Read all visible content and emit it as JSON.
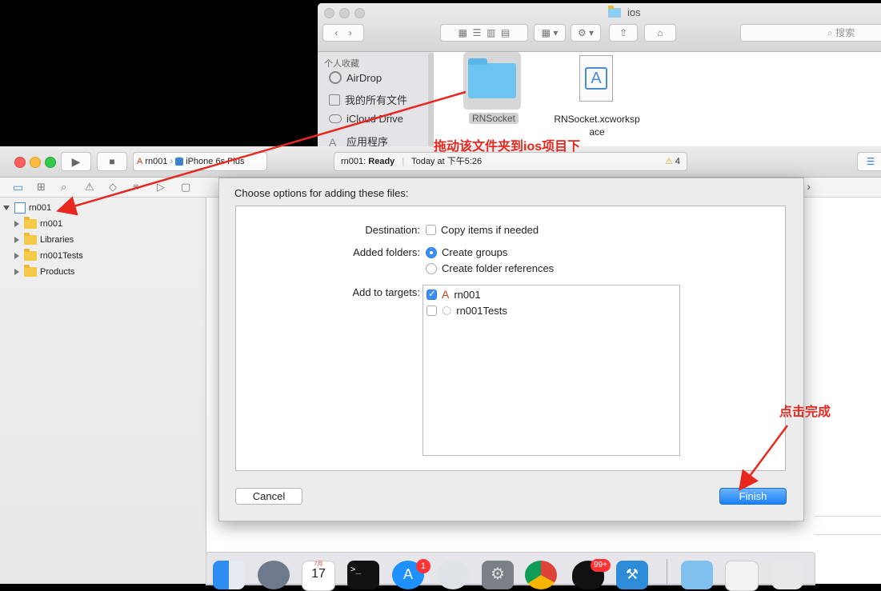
{
  "finder": {
    "title": "ios",
    "search_placeholder": "搜索",
    "sidebar_heading": "个人收藏",
    "sidebar_items": [
      {
        "label": "AirDrop",
        "icon": "airdrop-icon"
      },
      {
        "label": "我的所有文件",
        "icon": "all-files-icon"
      },
      {
        "label": "iCloud Drive",
        "icon": "icloud-icon"
      },
      {
        "label": "应用程序",
        "icon": "applications-icon"
      }
    ],
    "files": [
      {
        "name": "RNSocket",
        "icon": "folder-icon",
        "selected": true
      },
      {
        "name": "RNSocket.xcworksp ace",
        "icon": "xcworkspace-icon",
        "selected": false
      }
    ]
  },
  "xcode": {
    "scheme": "rn001",
    "device": "iPhone 6s Plus",
    "status_project": "rn001:",
    "status_state": "Ready",
    "status_time": "Today at 下午5:26",
    "warning_count": "4",
    "navigator": [
      {
        "label": "rn001",
        "level": 0,
        "open": true,
        "kind": "project"
      },
      {
        "label": "rn001",
        "level": 1,
        "open": false,
        "kind": "folder"
      },
      {
        "label": "Libraries",
        "level": 1,
        "open": false,
        "kind": "folder"
      },
      {
        "label": "rn001Tests",
        "level": 1,
        "open": false,
        "kind": "folder"
      },
      {
        "label": "Products",
        "level": 1,
        "open": false,
        "kind": "folder"
      }
    ]
  },
  "dialog": {
    "title": "Choose options for adding these files:",
    "destination_label": "Destination:",
    "copy_items": {
      "label": "Copy items if needed",
      "checked": false
    },
    "added_folders_label": "Added folders:",
    "create_groups": {
      "label": "Create groups",
      "selected": true
    },
    "create_folder_refs": {
      "label": "Create folder references",
      "selected": false
    },
    "targets_label": "Add to targets:",
    "targets": [
      {
        "label": "rn001",
        "checked": true
      },
      {
        "label": "rn001Tests",
        "checked": false
      }
    ],
    "cancel_label": "Cancel",
    "finish_label": "Finish"
  },
  "annotations": {
    "drag_hint": "拖动该文件夹到ios项目下",
    "finish_hint": "点击完成",
    "color": "#e8281f"
  },
  "dock": {
    "calendar_month": "7月",
    "calendar_day": "17",
    "appstore_badge": "1",
    "qq_badge": "99+"
  }
}
